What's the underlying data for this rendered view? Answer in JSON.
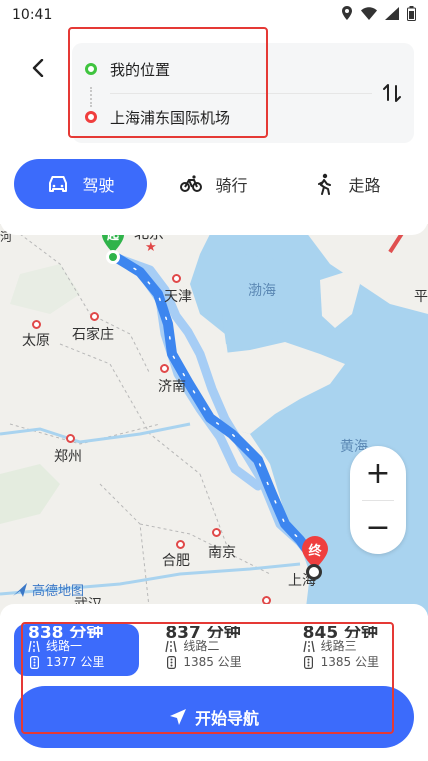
{
  "status_bar": {
    "time": "10:41"
  },
  "route": {
    "from": "我的位置",
    "to": "上海浦东国际机场"
  },
  "modes": [
    {
      "label": "驾驶",
      "icon": "car-icon",
      "active": true
    },
    {
      "label": "骑行",
      "icon": "bicycle-icon",
      "active": false
    },
    {
      "label": "走路",
      "icon": "walk-icon",
      "active": false
    }
  ],
  "map": {
    "labels": {
      "beijing": "北京",
      "tianjin": "天津",
      "bohai": "渤海",
      "ping": "平",
      "taiyuan": "太原",
      "shijiazhuang": "石家庄",
      "jinan": "济南",
      "huanghai": "黄海",
      "zhengzhou": "郑州",
      "hefei": "合肥",
      "nanjing": "南京",
      "shanghai": "上海",
      "wuhan": "武汉",
      "he": "河"
    },
    "start_marker": "起",
    "end_marker": "终",
    "watermark": "高德地图",
    "zoom_in": "+",
    "zoom_out": "−"
  },
  "route_options": [
    {
      "time": "838 分钟",
      "name": "线路一",
      "distance": "1377 公里",
      "active": true
    },
    {
      "time": "837 分钟",
      "name": "线路二",
      "distance": "1385 公里",
      "active": false
    },
    {
      "time": "845 分钟",
      "name": "线路三",
      "distance": "1385 公里",
      "active": false
    }
  ],
  "start_nav": "开始导航",
  "colors": {
    "accent": "#3c6bfb",
    "route": "#3d86ef",
    "alt_route": "#a6cdf5",
    "highlight": "#e53935"
  }
}
